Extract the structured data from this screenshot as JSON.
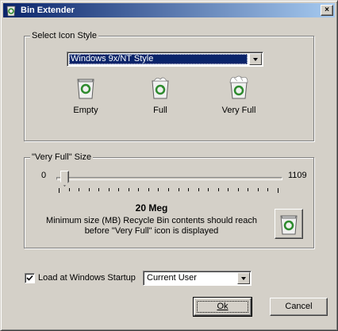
{
  "window": {
    "title": "Bin Extender",
    "close_glyph": "×"
  },
  "icon_style": {
    "group_label": "Select Icon Style",
    "selected": "Windows 9x/NT Style",
    "icons": [
      {
        "name": "recycle-bin-empty-icon",
        "label": "Empty"
      },
      {
        "name": "recycle-bin-full-icon",
        "label": "Full"
      },
      {
        "name": "recycle-bin-very-full-icon",
        "label": "Very Full"
      }
    ]
  },
  "very_full_size": {
    "group_label": "\"Very Full\" Size",
    "min_label": "0",
    "max_label": "1109",
    "slider_value_mb": 20,
    "value_text": "20 Meg",
    "description_line1": "Minimum size (MB) Recycle Bin contents should reach",
    "description_line2": "before \"Very Full\" icon is displayed"
  },
  "startup": {
    "checkbox_label": "Load at Windows Startup",
    "checked": true,
    "user_selected": "Current User"
  },
  "buttons": {
    "ok": "Ok",
    "cancel": "Cancel"
  },
  "colors": {
    "title_start": "#0a246a",
    "title_end": "#a6caf0",
    "face": "#d4d0c8",
    "bin_green": "#2e8b2e"
  }
}
